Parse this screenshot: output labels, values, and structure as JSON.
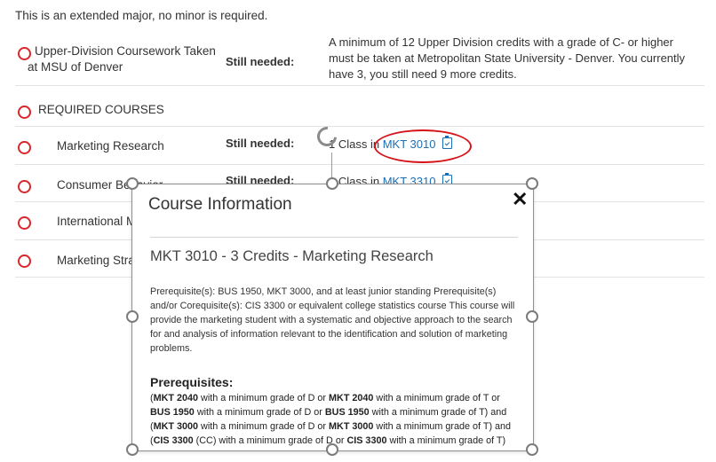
{
  "intro": "This is an extended major, no minor is required.",
  "rows": [
    {
      "title_line1": "Upper-Division Coursework Taken",
      "title_line2": "at MSU of Denver",
      "still": "Still needed:",
      "detail": [
        "A minimum of 12 Upper Division credits with a grade of C- or higher",
        "must be taken at Metropolitan State University - Denver. You currently",
        "have 3, you still need 9 more credits."
      ]
    },
    {
      "title": "REQUIRED COURSES"
    },
    {
      "title": "Marketing Research",
      "still": "Still needed:",
      "detail_prefix": "1 Class in",
      "course_link": "MKT 3010"
    },
    {
      "title": "Consumer Behavior",
      "still": "Still needed:",
      "detail_prefix": "1 Class in",
      "course_link": "MKT 3310"
    },
    {
      "title": "International M"
    },
    {
      "title": "Marketing Stra"
    }
  ],
  "dialog": {
    "title": "Course Information",
    "close": "✕",
    "course_heading": "MKT 3010 - 3 Credits - Marketing Research",
    "description": "Prerequisite(s): BUS 1950, MKT 3000, and at least junior standing Prerequisite(s) and/or Corequisite(s): CIS 3300 or equivalent college statistics course This course will provide the marketing student with a systematic and objective approach to the search for and analysis of information relevant to the identification and solution of marketing problems.",
    "prereq_heading": "Prerequisites:",
    "prereq": [
      {
        "a": "(",
        "b": "MKT 2040",
        "c": " with a minimum grade of D or ",
        "d": "MKT 2040",
        "e": " with a minimum grade of T or"
      },
      {
        "a": "",
        "b": "BUS 1950",
        "c": " with a minimum grade of D or ",
        "d": "BUS 1950",
        "e": " with a minimum grade of T) and"
      },
      {
        "a": "(",
        "b": "MKT 3000",
        "c": " with a minimum grade of D or ",
        "d": "MKT 3000",
        "e": " with a minimum grade of T) and"
      },
      {
        "a": "(",
        "b": "CIS 3300",
        "c": " (CC) with a minimum grade of D or ",
        "d": "CIS 3300",
        "e": " with a minimum grade of T)"
      }
    ]
  },
  "colors": {
    "accent_red": "#d9262b",
    "link_blue": "#1a6fb5",
    "highlight_ellipse": "#d6151b"
  },
  "icons": {
    "status": "empty-circle-icon",
    "clipboard": "clipboard-check-icon",
    "rotate": "rotate-handle-icon"
  }
}
